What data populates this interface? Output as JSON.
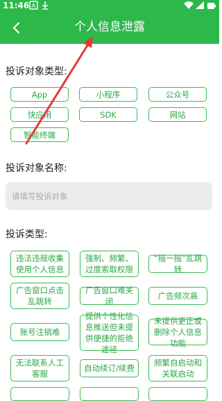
{
  "status_bar": {
    "time": "11:46",
    "left_icons": [
      "font-icon",
      "download-icon"
    ],
    "right_icons": [
      "wifi-icon",
      "signal-icon",
      "battery-icon"
    ]
  },
  "header": {
    "title": "个人信息泄露",
    "back_icon": "chevron-left-icon"
  },
  "colors": {
    "primary": "#2db84a",
    "chip_border": "#3dba53",
    "chip_text": "#2aa745",
    "input_bg": "#ececec",
    "annotation_arrow": "#e53935"
  },
  "complaint_object_type": {
    "label": "投诉对象类型:",
    "options": [
      "App",
      "小程序",
      "公众号",
      "快应用",
      "SDK",
      "网站",
      "智能终端"
    ]
  },
  "complaint_object_name": {
    "label": "投诉对象名称:",
    "placeholder": "请填写投诉对象",
    "value": ""
  },
  "complaint_type": {
    "label": "投诉类型:",
    "options": [
      "违法违规收集使用个人信息",
      "强制、频繁、过度索取权限",
      "“摇一摇”乱跳转",
      "广告窗口点击乱跳转",
      "广告窗口难关闭",
      "广告频次高",
      "账号注销难",
      "提供个性化信息推送但未提供便捷的拒绝途径",
      "未提供更正或删除个人信息功能",
      "无法联系人工客服",
      "自动续订/续费",
      "频繁自启动和关联启动"
    ]
  }
}
